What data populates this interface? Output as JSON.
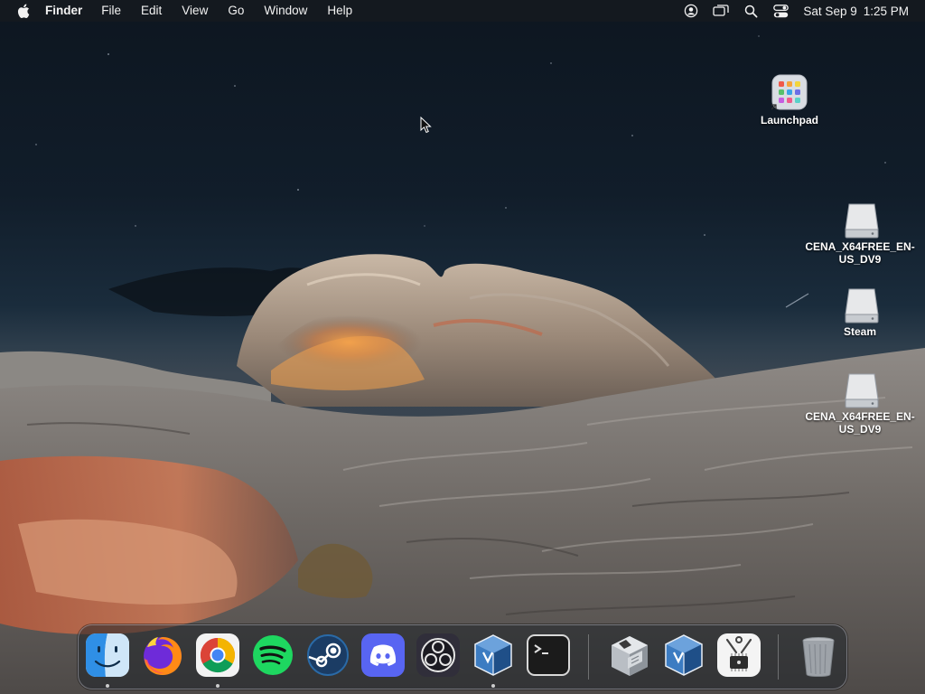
{
  "menubar": {
    "apple_icon": "apple-logo-icon",
    "app_name": "Finder",
    "menus": [
      "File",
      "Edit",
      "View",
      "Go",
      "Window",
      "Help"
    ],
    "status_icons": [
      "user-account-icon",
      "screen-mirroring-icon",
      "spotlight-search-icon",
      "control-center-icon"
    ],
    "clock": {
      "date": "Sat Sep 9",
      "time": "1:25 PM"
    }
  },
  "desktop": {
    "icons": [
      {
        "label": "Launchpad",
        "icon": "launchpad-icon",
        "type": "alias"
      },
      {
        "label": "CENA_X64FREE_EN-US_DV9",
        "icon": "disk-image-icon",
        "type": "volume"
      },
      {
        "label": "Steam",
        "icon": "disk-image-icon",
        "type": "volume"
      },
      {
        "label": "CENA_X64FREE_EN-US_DV9",
        "icon": "disk-image-icon",
        "type": "volume"
      }
    ]
  },
  "dock": {
    "apps": [
      {
        "name": "Finder",
        "icon": "finder-icon",
        "running": true
      },
      {
        "name": "Firefox",
        "icon": "firefox-icon",
        "running": false
      },
      {
        "name": "Google Chrome",
        "icon": "chrome-icon",
        "running": true
      },
      {
        "name": "Spotify",
        "icon": "spotify-icon",
        "running": false
      },
      {
        "name": "Steam",
        "icon": "steam-icon",
        "running": false
      },
      {
        "name": "Discord",
        "icon": "discord-icon",
        "running": false
      },
      {
        "name": "OBS",
        "icon": "obs-icon",
        "running": false
      },
      {
        "name": "VirtualBox",
        "icon": "virtualbox-icon",
        "running": true
      },
      {
        "name": "Terminal",
        "icon": "terminal-icon",
        "running": false
      }
    ],
    "recents": [
      {
        "name": "Boot Camp Assistant",
        "icon": "bootcamp-icon"
      },
      {
        "name": "VirtualBox",
        "icon": "virtualbox-icon"
      },
      {
        "name": "System Information",
        "icon": "system-information-icon"
      }
    ],
    "trash": {
      "name": "Trash",
      "icon": "trash-icon"
    }
  },
  "colors": {
    "menubar_bg": "#161a20",
    "sky_top": "#0d1620",
    "rock_orange": "#e08a3c",
    "rock_grey": "#8a8580"
  }
}
